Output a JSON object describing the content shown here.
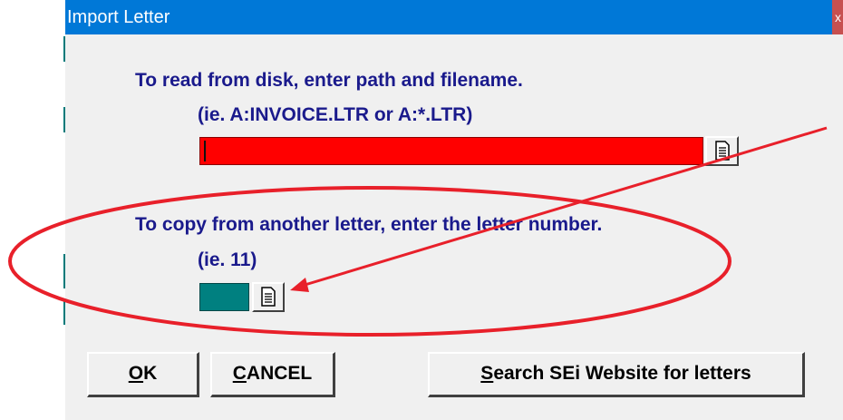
{
  "dialog": {
    "title": "Import Letter",
    "close_label": "x"
  },
  "disk_section": {
    "instruction": "To read from disk, enter path and filename.",
    "example": "(ie. A:INVOICE.LTR  or  A:*.LTR)",
    "path_value": "",
    "field_color": "#ff0000",
    "browse_icon": "document-icon"
  },
  "copy_section": {
    "instruction": "To copy from another letter, enter the letter number.",
    "example": "(ie. 11)",
    "letter_number_value": "",
    "field_color": "#008080",
    "browse_icon": "document-icon"
  },
  "buttons": {
    "ok_mnemonic": "O",
    "ok_rest": "K",
    "cancel_mnemonic": "C",
    "cancel_rest": "ANCEL",
    "search_mnemonic": "S",
    "search_rest": "earch SEi Website for letters"
  },
  "annotation": {
    "color": "#e8202a"
  }
}
